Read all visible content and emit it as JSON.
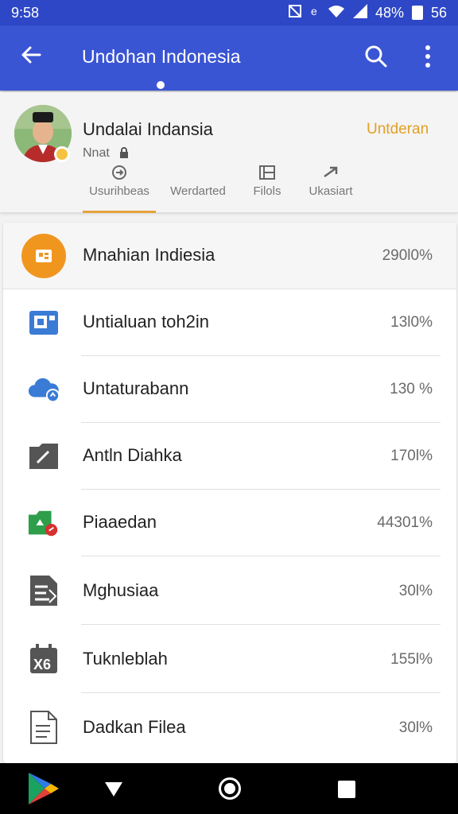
{
  "status_bar": {
    "time": "9:58",
    "battery_text": "48%",
    "signal_text": "56",
    "icons": [
      "no-nfc-icon",
      "e-network-icon",
      "wifi-icon",
      "signal-icon",
      "battery-icon"
    ]
  },
  "app_bar": {
    "title": "Undohan Indonesia",
    "icons": [
      "back-arrow-icon",
      "search-icon",
      "more-vert-icon"
    ]
  },
  "profile": {
    "name": "Undalai Indansia",
    "subtitle": "Nnat",
    "action_label": "Untderan",
    "tabs": [
      {
        "label": "Usurihbeas",
        "icon": "share-icon"
      },
      {
        "label": "Werdarted",
        "icon": ""
      },
      {
        "label": "Filols",
        "icon": "files-icon"
      },
      {
        "label": "Ukasiart",
        "icon": "forward-icon"
      }
    ],
    "accent_color": "#e6a23c"
  },
  "list": {
    "header": {
      "label": "Mnahian Indiesia",
      "value": "290l0%",
      "icon": "app-icon"
    },
    "items": [
      {
        "label": "Untialuan toh2in",
        "value": "13l0%",
        "icon": "image-icon"
      },
      {
        "label": "Untaturabann",
        "value": "130 %",
        "icon": "cloud-icon"
      },
      {
        "label": "Antln Diahka",
        "value": "170l%",
        "icon": "folder-edit-icon"
      },
      {
        "label": "Piaaedan",
        "value": "44301%",
        "icon": "folder-green-icon"
      },
      {
        "label": "Mghusiaa",
        "value": "30l%",
        "icon": "document-icon"
      },
      {
        "label": "Tuknleblah",
        "value": "155l%",
        "icon": "calendar-icon"
      },
      {
        "label": "Dadkan Filea",
        "value": "30l%",
        "icon": "file-icon"
      }
    ]
  },
  "colors": {
    "status_bar": "#2d47c6",
    "app_bar": "#3a55d4",
    "header_icon": "#f0961f",
    "accent": "#e2a024"
  }
}
